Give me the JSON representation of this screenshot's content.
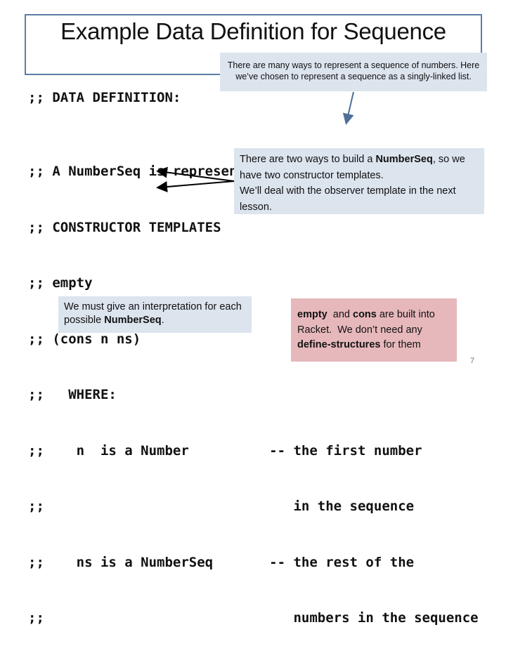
{
  "slide": {
    "title": "Example Data Definition for Sequence",
    "page_number": "7"
  },
  "callouts": {
    "representation": {
      "line1": "There are many ways to represent a sequence of numbers.  Here",
      "line2": "we’ve chosen to represent a sequence as a singly-linked list."
    },
    "constructors": {
      "pre": "There are two ways to build a ",
      "bold": "NumberSeq",
      "post": ", so we have two constructor templates.",
      "line3": "We’ll deal with the observer template in the next lesson."
    },
    "interpretation": {
      "pre": "We must give an interpretation for each possible ",
      "bold": "NumberSeq",
      "post": "."
    },
    "builtin": {
      "bold1": "empty",
      "t1": "  and ",
      "bold2": "cons",
      "t2": " are built into Racket.  We don’t need any ",
      "bold3": "define-structures",
      "t3": " for them"
    }
  },
  "code": {
    "header": ";; DATA DEFINITION:",
    "lines": [
      ";; A NumberSeq is represented as a list of Number.",
      ";; CONSTRUCTOR TEMPLATES",
      ";; empty",
      ";; (cons n ns)",
      ";;   WHERE:",
      ";;    n  is a Number          -- the first number",
      ";;                               in the sequence",
      ";;    ns is a NumberSeq       -- the rest of the",
      ";;                               numbers in the sequence"
    ]
  },
  "colors": {
    "title_border": "#5b7ea6",
    "callout_blue": "#dce4ee",
    "callout_pink": "#e6b8bc",
    "arrow_blue": "#4f6f99"
  }
}
